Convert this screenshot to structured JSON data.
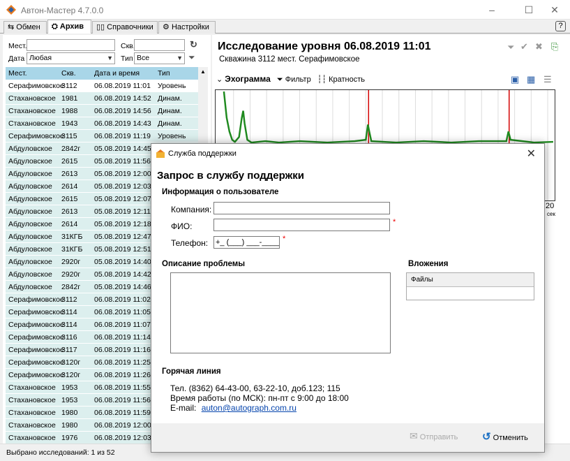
{
  "window": {
    "title": "Автон-Мастер 4.7.0.0"
  },
  "tabs": [
    {
      "label": "Обмен"
    },
    {
      "label": "Архив"
    },
    {
      "label": "Справочники"
    },
    {
      "label": "Настройки"
    }
  ],
  "filters": {
    "place_label": "Мест.",
    "well_label": "Скв.",
    "date_label": "Дата",
    "date_value": "Любая",
    "type_label": "Тип",
    "type_value": "Все"
  },
  "table": {
    "headers": [
      "Мест.",
      "Скв.",
      "Дата и время",
      "Тип"
    ],
    "rows": [
      [
        "Серафимовское",
        "3112",
        "06.08.2019 11:01",
        "Уровень"
      ],
      [
        "Стахановское",
        "1981",
        "06.08.2019 14:52",
        "Динам."
      ],
      [
        "Стахановское",
        "1988",
        "06.08.2019 14:56",
        "Динам."
      ],
      [
        "Стахановское",
        "1943",
        "06.08.2019 14:43",
        "Динам."
      ],
      [
        "Серафимовское",
        "3115",
        "06.08.2019 11:19",
        "Уровень"
      ],
      [
        "Абдуловское",
        "2842г",
        "05.08.2019 14:45",
        ""
      ],
      [
        "Абдуловское",
        "2615",
        "05.08.2019 11:56",
        ""
      ],
      [
        "Абдуловское",
        "2613",
        "05.08.2019 12:00",
        ""
      ],
      [
        "Абдуловское",
        "2614",
        "05.08.2019 12:03",
        ""
      ],
      [
        "Абдуловское",
        "2615",
        "05.08.2019 12:07",
        ""
      ],
      [
        "Абдуловское",
        "2613",
        "05.08.2019 12:11",
        ""
      ],
      [
        "Абдуловское",
        "2614",
        "05.08.2019 12:18",
        ""
      ],
      [
        "Абдуловское",
        "31КГБ",
        "05.08.2019 12:47",
        ""
      ],
      [
        "Абдуловское",
        "31КГБ",
        "05.08.2019 12:51",
        ""
      ],
      [
        "Абдуловское",
        "2920г",
        "05.08.2019 14:40",
        ""
      ],
      [
        "Абдуловское",
        "2920г",
        "05.08.2019 14:42",
        ""
      ],
      [
        "Абдуловское",
        "2842г",
        "05.08.2019 14:46",
        ""
      ],
      [
        "Серафимовское",
        "3112",
        "06.08.2019 11:02",
        ""
      ],
      [
        "Серафимовское",
        "3114",
        "06.08.2019 11:05",
        ""
      ],
      [
        "Серафимовское",
        "3114",
        "06.08.2019 11:07",
        ""
      ],
      [
        "Серафимовское",
        "3116",
        "06.08.2019 11:14",
        ""
      ],
      [
        "Серафимовское",
        "3117",
        "06.08.2019 11:16",
        ""
      ],
      [
        "Серафимовское",
        "3120г",
        "06.08.2019 11:25",
        ""
      ],
      [
        "Серафимовское",
        "3120г",
        "06.08.2019 11:26",
        ""
      ],
      [
        "Стахановское",
        "1953",
        "06.08.2019 11:55",
        ""
      ],
      [
        "Стахановское",
        "1953",
        "06.08.2019 11:56",
        ""
      ],
      [
        "Стахановское",
        "1980",
        "06.08.2019 11:59",
        ""
      ],
      [
        "Стахановское",
        "1980",
        "06.08.2019 12:00",
        ""
      ],
      [
        "Стахановское",
        "1976",
        "06.08.2019 12:03",
        ""
      ]
    ]
  },
  "status": {
    "text": "Выбрано исследований: 1 из 52"
  },
  "study": {
    "title": "Исследование уровня 06.08.2019 11:01",
    "subtitle": "Скважина 3112 мест. Серафимовское",
    "echo_label": "Эхограмма",
    "filter_label": "Фильтр",
    "multiplicity_label": "Кратность",
    "axis_tick": "20",
    "axis_unit": "сек"
  },
  "dialog": {
    "window_title": "Служба поддержки",
    "heading": "Запрос в службу поддержки",
    "user_info": "Информация о пользователе",
    "company_label": "Компания:",
    "fio_label": "ФИО:",
    "phone_label": "Телефон:",
    "phone_value": "+_ (___) ___-____",
    "required_mark": "*",
    "problem_label": "Описание проблемы",
    "attachments_label": "Вложения",
    "files_header": "Файлы",
    "hotline_label": "Горячая линия",
    "hotline_phone": "Тел. (8362) 64-43-00, 63-22-10, доб.123; 115",
    "hotline_hours": "Время работы (по МСК): пн-пт с 9:00 до 18:00",
    "email_label": "E-mail:",
    "email": "auton@autograph.com.ru",
    "send_label": "Отправить",
    "cancel_label": "Отменить"
  },
  "colors": {
    "accent": "#a9d6e8",
    "row": "#dcefee",
    "echo_green": "#1f8a1f",
    "echo_red": "#d40000"
  }
}
